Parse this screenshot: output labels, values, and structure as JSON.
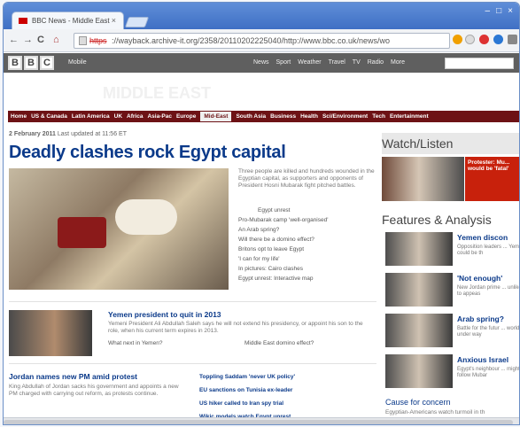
{
  "browser": {
    "tab_title": "BBC News - Middle East",
    "tab_close": "×",
    "window_controls": [
      "–",
      "□",
      "×"
    ],
    "nav": {
      "back": "←",
      "forward": "→",
      "reload": "C",
      "home": "⌂"
    },
    "url_scheme": "https",
    "url_rest": "://wayback.archive-it.org/2358/20110202225040/http://www.bbc.co.uk/news/wo"
  },
  "masthead": {
    "logo_letters": [
      "B",
      "B",
      "C"
    ],
    "mobile": "Mobile",
    "nav_items": [
      "News",
      "Sport",
      "Weather",
      "Travel",
      "TV",
      "Radio",
      "More"
    ],
    "ghost_text": "MIDDLE EAST"
  },
  "section_nav": [
    "Home",
    "US & Canada",
    "Latin America",
    "UK",
    "Africa",
    "Asia-Pac",
    "Europe",
    "Mid-East",
    "South Asia",
    "Business",
    "Health",
    "Sci/Environment",
    "Tech",
    "Entertainment"
  ],
  "main": {
    "date": "2 February 2011",
    "updated": "Last updated at 11:56 ET",
    "headline": "Deadly clashes rock Egypt capital",
    "summary": "Three people are killed and hundreds wounded in the Egyptian capital, as supporters and opponents of President Hosni Mubarak fight pitched battles.",
    "links": [
      "Egypt unrest",
      "Pro-Mubarak camp 'well-organised'",
      "An Arab spring?",
      "Will there be a domino effect?",
      "Britons opt to leave Egypt",
      "'I can for my life'",
      "In pictures: Cairo clashes",
      "Egypt unrest: Interactive map"
    ]
  },
  "story_yemen": {
    "title": "Yemen president to quit in 2013",
    "summary": "Yemeni President Ali Abdullah Saleh says he will not extend his presidency, or appoint his son to the role, when his current term expires in 2013.",
    "links": [
      "What next in Yemen?",
      "Middle East domino effect?"
    ]
  },
  "story_jordan": {
    "title": "Jordan names new PM amid protest",
    "summary": "King Abdullah of Jordan sacks his government and appoints a new PM charged with carrying out reform, as protests continue."
  },
  "mini_links": [
    "Toppling Saddam 'never UK policy'",
    "EU sanctions on Tunisia ex-leader",
    "US hiker called to Iran spy trial",
    "Wikic models watch Egypt unrest"
  ],
  "sidebar": {
    "watch_heading": "Watch/Listen",
    "watch_caption": "Protester: Mu... would be 'fatal'",
    "features_heading": "Features & Analysis",
    "features": [
      {
        "title": "Yemen discon",
        "summary": "Opposition leaders ... Yemen could be th"
      },
      {
        "title": "'Not enough'",
        "summary": "New Jordan prime ... unlikely to appeas"
      },
      {
        "title": "Arab spring?",
        "summary": "Battle for the futur ... world is under way"
      },
      {
        "title": "Anxious Israel",
        "summary": "Egypt's neighbour ... might follow Mubar"
      }
    ],
    "concern_title": "Cause for concern",
    "concern_summary": "Egyptian-Americans watch turmoil in th"
  }
}
